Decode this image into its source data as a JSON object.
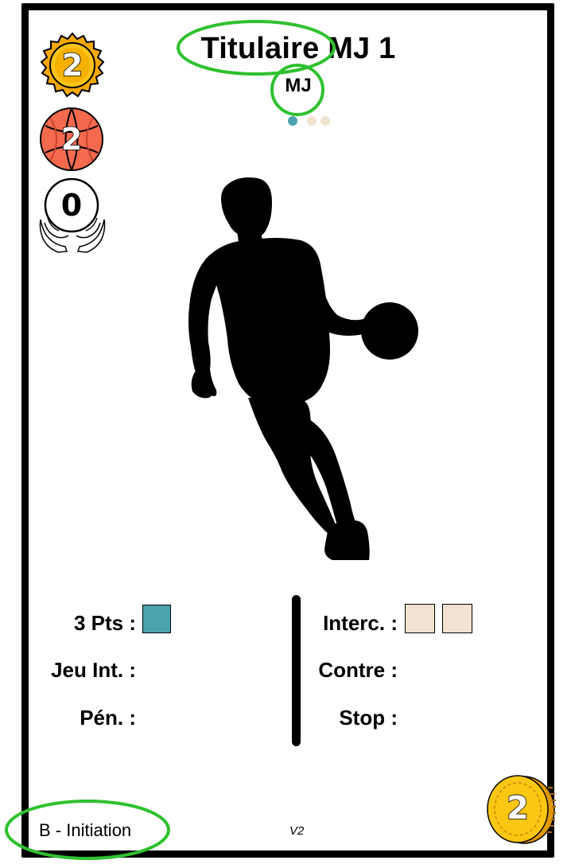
{
  "card": {
    "title": "Titulaire MJ 1",
    "position": "MJ",
    "level": "B - Initiation",
    "version": "V2"
  },
  "badges": {
    "gold_coin_value": "2",
    "basketball_value": "2",
    "hands_value": "0",
    "cost_coin_value": "2"
  },
  "indicator_dots": [
    {
      "state": "active",
      "color": "#4aa3ae"
    },
    {
      "state": "inactive",
      "color": "#f1e3cf"
    },
    {
      "state": "inactive",
      "color": "#f1e3cf"
    }
  ],
  "stats_left": [
    {
      "label": "3 Pts :",
      "boxes": 1,
      "box_color": "#4aa3ae"
    },
    {
      "label": "Jeu Int. :",
      "boxes": 0
    },
    {
      "label": "Pén. :",
      "boxes": 0
    }
  ],
  "stats_right": [
    {
      "label": "Interc. :",
      "boxes": 2,
      "box_color": "#f1e3cf"
    },
    {
      "label": "Contre :",
      "boxes": 0
    },
    {
      "label": "Stop :",
      "boxes": 0
    }
  ],
  "colors": {
    "annotation_green": "#2fc12f",
    "teal": "#4aa3ae",
    "beige": "#f1e3cf",
    "gold": "#f5b800",
    "basketball": "#f46a4e"
  },
  "icons": [
    "gold-coin-icon",
    "basketball-icon",
    "hands-ball-icon",
    "player-silhouette",
    "cost-coin-icon"
  ]
}
